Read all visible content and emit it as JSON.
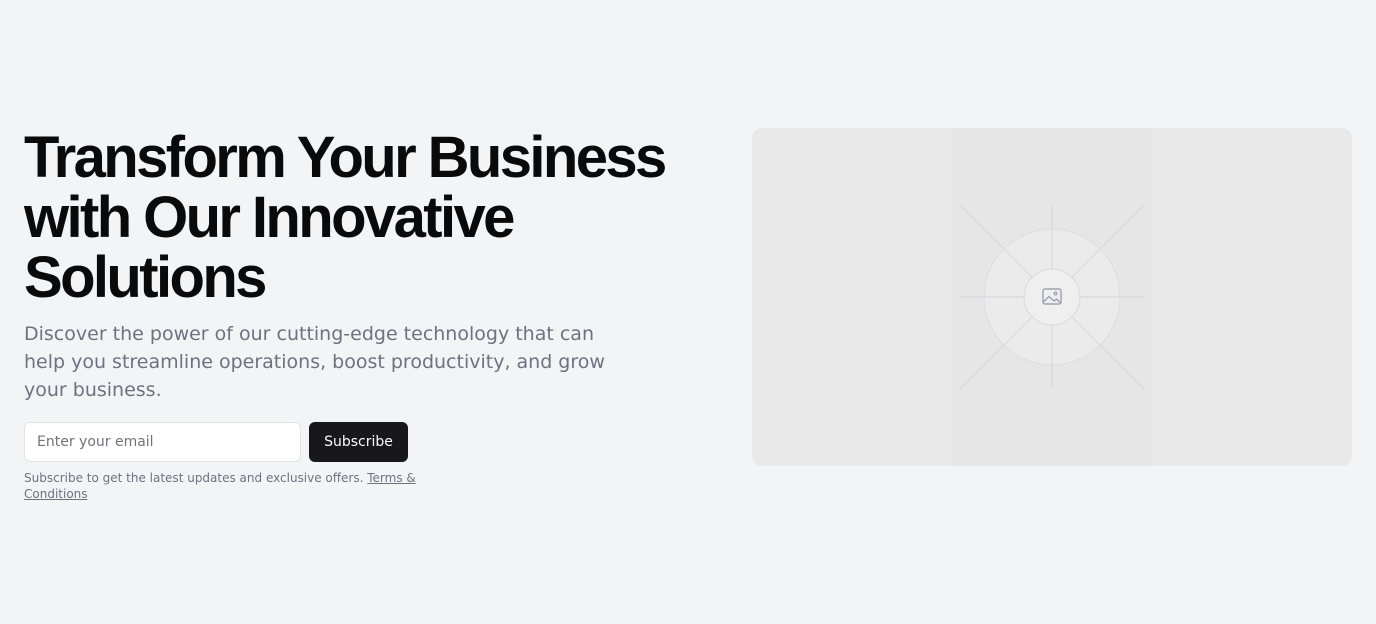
{
  "hero": {
    "title": "Transform Your Business with Our Innovative Solutions",
    "subtitle": "Discover the power of our cutting-edge technology that can help you streamline operations, boost productivity, and grow your business.",
    "email_placeholder": "Enter your email",
    "subscribe_label": "Subscribe",
    "note_text": "Subscribe to get the latest updates and exclusive offers. ",
    "terms_link": "Terms & Conditions"
  },
  "media": {
    "icon": "image-placeholder-icon"
  },
  "colors": {
    "background": "#f3f4f6",
    "heading": "#0a0a0a",
    "muted_text": "#6b7280",
    "button": "#18181b",
    "button_text": "#fafafa",
    "placeholder_bg": "#e9e9ea"
  }
}
